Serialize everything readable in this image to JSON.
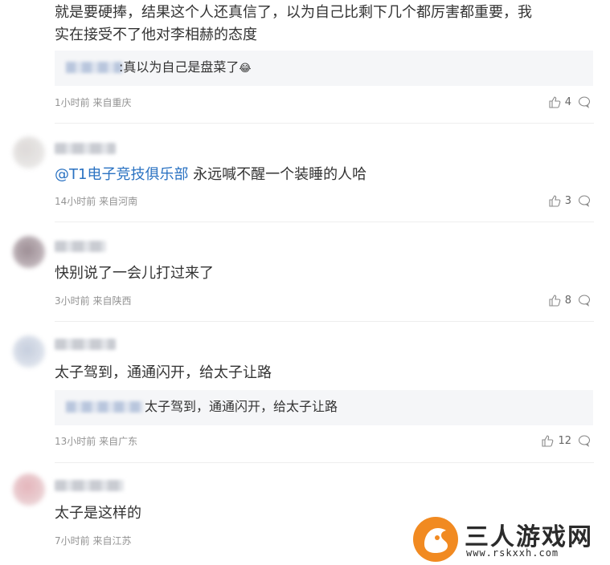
{
  "comments": [
    {
      "text": "就是要硬捧，结果这个人还真信了，以为自己比剩下几个都厉害都重要，我实在接受不了他对李相赫的态度",
      "text_line1": "就是要硬捧，结果这个人还真信了，以为自己比剩下几个都厉害都重要，我",
      "text_line2": "实在接受不了他对李相赫的态度",
      "reply": {
        "text": ":真以为自己是盘菜了",
        "emoji": "😂"
      },
      "meta": "1小时前 来自重庆",
      "likes": "4"
    },
    {
      "mention": "@T1电子竞技俱乐部",
      "text": " 永远喊不醒一个装睡的人哈",
      "meta": "14小时前 来自河南",
      "likes": "3"
    },
    {
      "text": "快别说了一会儿打过来了",
      "meta": "3小时前 来自陕西",
      "likes": "8"
    },
    {
      "text": "太子驾到，通通闪开，给太子让路",
      "reply": {
        "text": "太子驾到，通通闪开，给太子让路"
      },
      "meta": "13小时前 来自广东",
      "likes": "12"
    },
    {
      "text": "太子是这样的",
      "meta": "7小时前 来自江苏"
    }
  ],
  "icons": {
    "like": "thumbs-up-icon",
    "comment": "comment-bubble-icon"
  },
  "watermark": {
    "title": "三人游戏网",
    "url": "www.rskxxh.com"
  },
  "colors": {
    "mention": "#2a72c2",
    "meta": "#939393",
    "reply_bg": "#f5f6f8",
    "logo": "#f18a21"
  }
}
